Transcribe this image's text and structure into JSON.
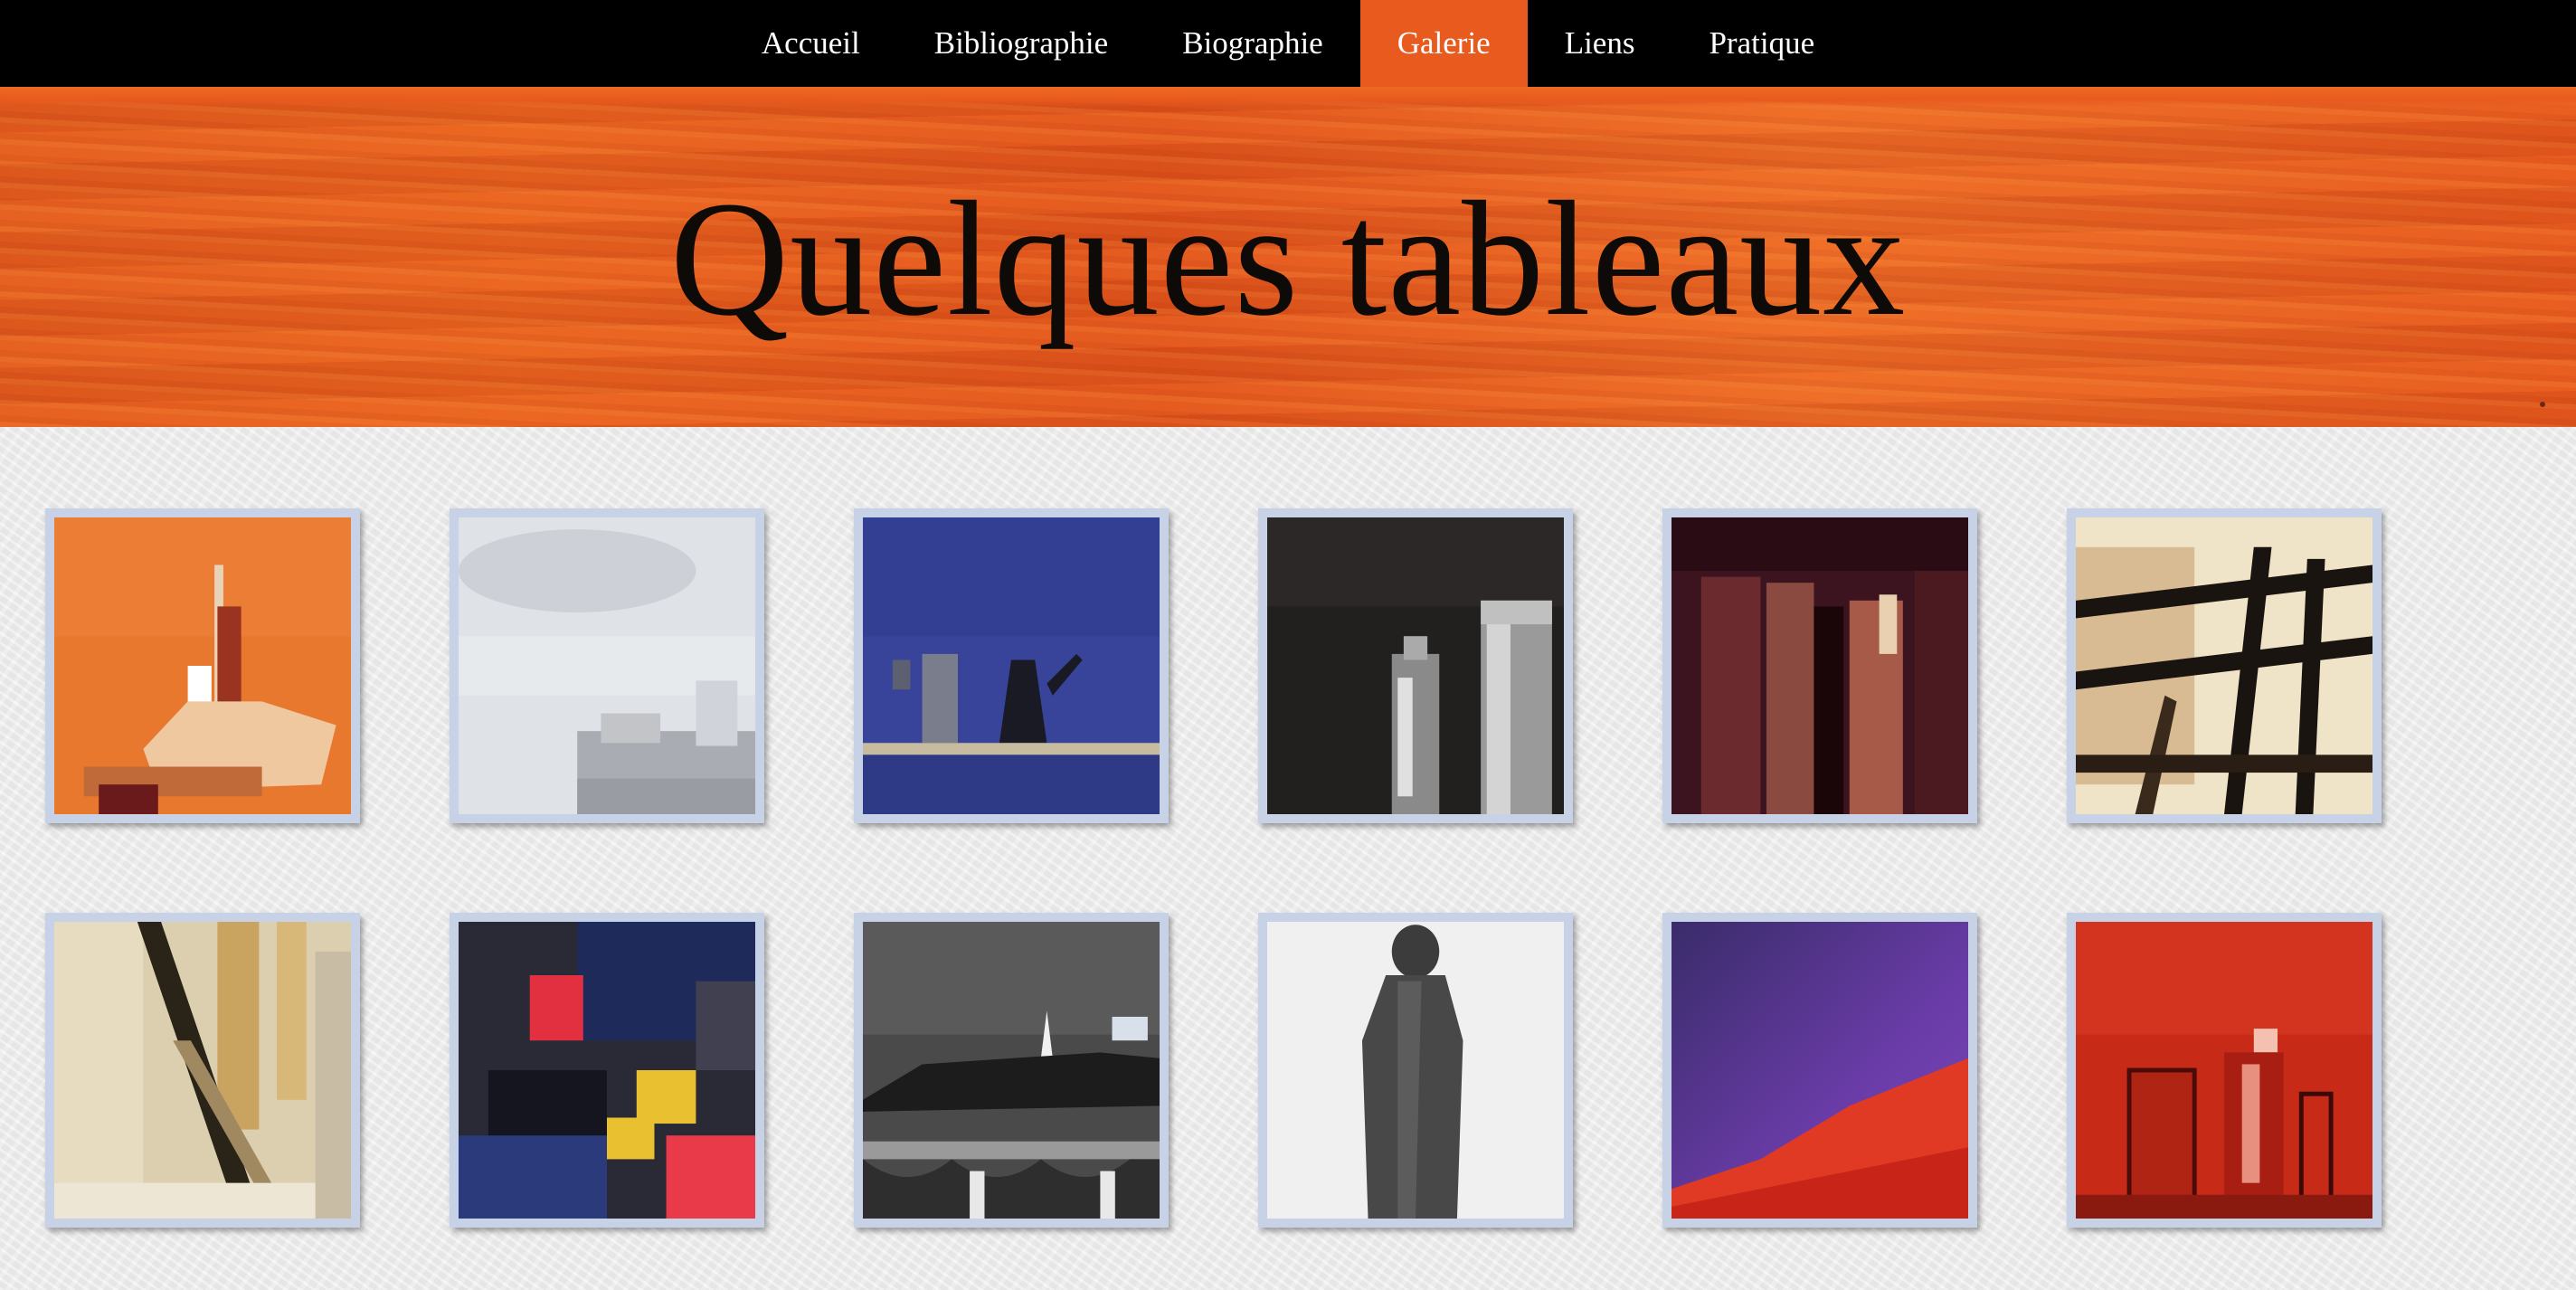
{
  "nav": {
    "items": [
      {
        "label": "Accueil",
        "active": false
      },
      {
        "label": "Bibliographie",
        "active": false
      },
      {
        "label": "Biographie",
        "active": false
      },
      {
        "label": "Galerie",
        "active": true
      },
      {
        "label": "Liens",
        "active": false
      },
      {
        "label": "Pratique",
        "active": false
      }
    ]
  },
  "banner": {
    "title": "Quelques tableaux"
  },
  "gallery": {
    "count": 12,
    "items": [
      {
        "subject": "still life with bottles on orange ground",
        "dominant_color": "#e8782e"
      },
      {
        "subject": "pale grey landscape",
        "dominant_color": "#d8dde2"
      },
      {
        "subject": "jugs and coffee pot on blue ground",
        "dominant_color": "#37449a"
      },
      {
        "subject": "grey bottles on black ground",
        "dominant_color": "#2a2626"
      },
      {
        "subject": "dark brown abstract",
        "dominant_color": "#4a1a1e"
      },
      {
        "subject": "black strokes on cream",
        "dominant_color": "#e8d8b4"
      },
      {
        "subject": "cream and ochre abstract strokes",
        "dominant_color": "#d8ccb0"
      },
      {
        "subject": "black, blue, red and yellow blocks",
        "dominant_color": "#2a2a3a"
      },
      {
        "subject": "grey landscape with bridge",
        "dominant_color": "#555555"
      },
      {
        "subject": "standing figure on white",
        "dominant_color": "#e6e6e6"
      },
      {
        "subject": "purple sky over red ground",
        "dominant_color": "#6a3ca0"
      },
      {
        "subject": "red still life",
        "dominant_color": "#c82a18"
      }
    ]
  },
  "colors": {
    "nav_bg": "#000000",
    "active_tab": "#e85a1e",
    "banner": "#e5561f",
    "frame": "#c8d2e6"
  }
}
